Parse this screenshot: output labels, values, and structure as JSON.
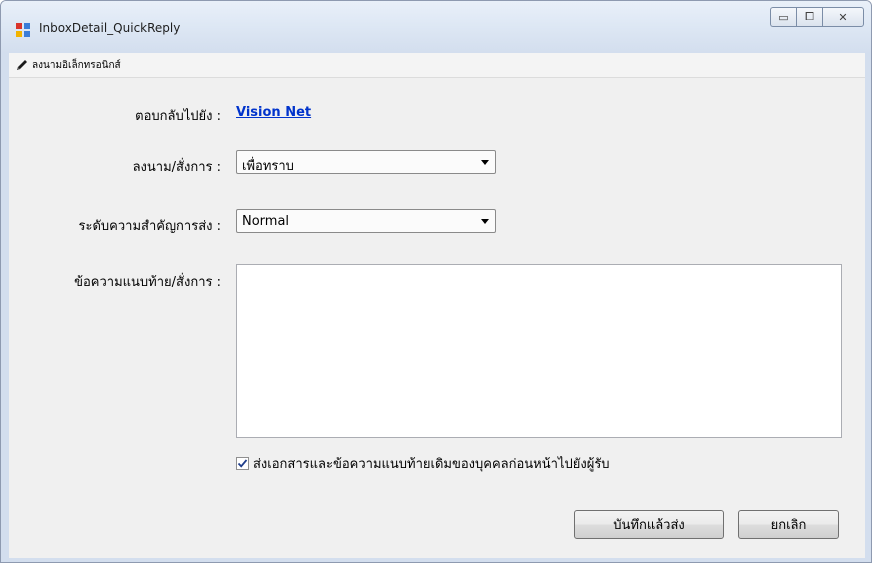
{
  "window": {
    "title": "InboxDetail_QuickReply",
    "caption": {
      "minimize": "▭",
      "maximize": "⧠",
      "close": "✕"
    }
  },
  "menubar": {
    "sign_label": "ลงนามอิเล็กทรอนิกส์"
  },
  "form": {
    "reply_to_label": "ตอบกลับไปยัง :",
    "reply_to_value": "Vision Net",
    "sign_order_label": "ลงนาม/สั่งการ :",
    "sign_order_value": "เพื่อทราบ",
    "priority_label": "ระดับความสำคัญการส่ง :",
    "priority_value": "Normal",
    "message_label": "ข้อความแนบท้าย/สั่งการ :",
    "message_value": "",
    "forward_checkbox_label": "ส่งเอกสารและข้อความแนบท้ายเดิมของบุคคลก่อนหน้าไปยังผู้รับ",
    "forward_checked": true
  },
  "buttons": {
    "save_send": "บันทึกแล้วส่ง",
    "cancel": "ยกเลิก"
  },
  "colors": {
    "link": "#0033cc",
    "titlebar": "#dde7f4"
  }
}
